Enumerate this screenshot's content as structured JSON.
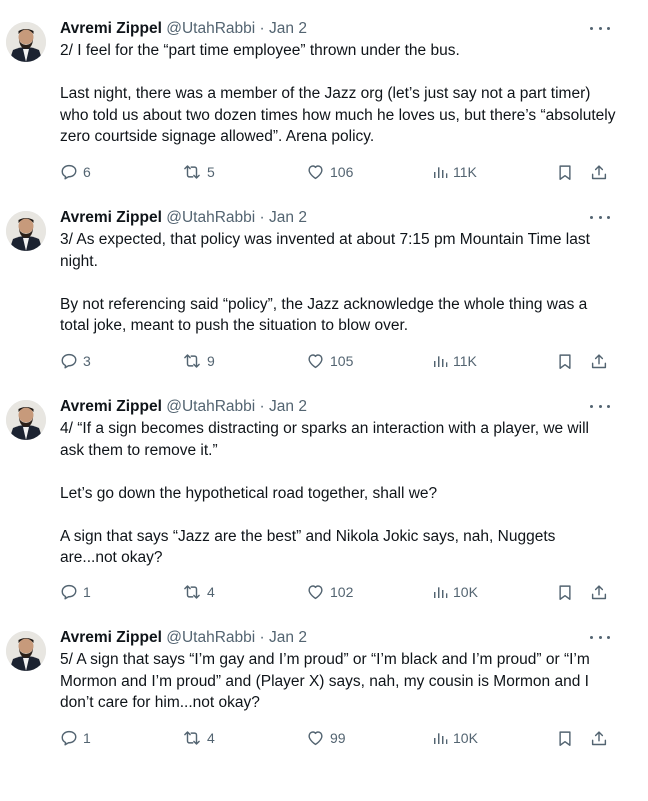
{
  "tweets": [
    {
      "author": {
        "name": "Avremi Zippel",
        "handle": "@UtahRabbi",
        "date": "Jan 2"
      },
      "paragraphs": [
        "2/ I feel for the “part time employee” thrown under the bus.",
        "Last night, there was a member of the Jazz org (let’s just say not a part timer) who told us about two dozen times how much he loves us, but there’s “absolutely zero courtside signage allowed”. Arena policy."
      ],
      "stats": {
        "replies": "6",
        "reposts": "5",
        "likes": "106",
        "views": "11K"
      }
    },
    {
      "author": {
        "name": "Avremi Zippel",
        "handle": "@UtahRabbi",
        "date": "Jan 2"
      },
      "paragraphs": [
        "3/ As expected, that policy was invented at about 7:15 pm Mountain Time last night.",
        "By not referencing said “policy”, the Jazz acknowledge the whole thing was a total joke, meant to push the situation to blow over."
      ],
      "stats": {
        "replies": "3",
        "reposts": "9",
        "likes": "105",
        "views": "11K"
      }
    },
    {
      "author": {
        "name": "Avremi Zippel",
        "handle": "@UtahRabbi",
        "date": "Jan 2"
      },
      "paragraphs": [
        "4/ “If a sign becomes distracting or sparks an interaction with a player, we will ask them to remove it.”",
        "Let’s go down the hypothetical road together, shall we?",
        "A sign that says “Jazz are the best” and Nikola Jokic says, nah, Nuggets are...not okay?"
      ],
      "stats": {
        "replies": "1",
        "reposts": "4",
        "likes": "102",
        "views": "10K"
      }
    },
    {
      "author": {
        "name": "Avremi Zippel",
        "handle": "@UtahRabbi",
        "date": "Jan 2"
      },
      "paragraphs": [
        "5/ A sign that says “I’m gay and I’m proud” or “I’m black and I’m proud” or “I’m Mormon and I’m proud” and (Player X) says, nah, my cousin is Mormon and I don’t care for him...not okay?"
      ],
      "stats": {
        "replies": "1",
        "reposts": "4",
        "likes": "99",
        "views": "10K"
      }
    }
  ],
  "separator": "·",
  "icons": {
    "reply": "reply-icon",
    "repost": "repost-icon",
    "like": "heart-icon",
    "views": "views-icon",
    "bookmark": "bookmark-icon",
    "share": "share-icon",
    "more": "more-icon"
  },
  "colors": {
    "text": "#0f1419",
    "muted": "#536471",
    "background": "#ffffff"
  }
}
